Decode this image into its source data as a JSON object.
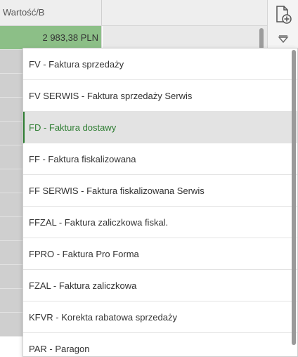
{
  "header": {
    "column_title": "Wartość/B"
  },
  "grid": {
    "first_row_value": "2 983,38 PLN"
  },
  "toolbar": {
    "add_document_icon": "document-plus-icon",
    "filter_icon": "funnel-icon"
  },
  "dropdown": {
    "options": [
      "FV - Faktura sprzedaży",
      "FV SERWIS - Faktura sprzedaży Serwis",
      "FD - Faktura dostawy",
      "FF - Faktura fiskalizowana",
      "FF SERWIS - Faktura fiskalizowana Serwis",
      "FFZAL - Faktura zaliczkowa fiskal.",
      "FPRO - Faktura Pro Forma",
      "FZAL - Faktura zaliczkowa",
      "KFVR - Korekta rabatowa sprzedaży",
      "PAR - Paragon"
    ],
    "selected_index": 2
  },
  "colors": {
    "accent": "#2e7d32",
    "row_highlight": "#8cbf87"
  }
}
